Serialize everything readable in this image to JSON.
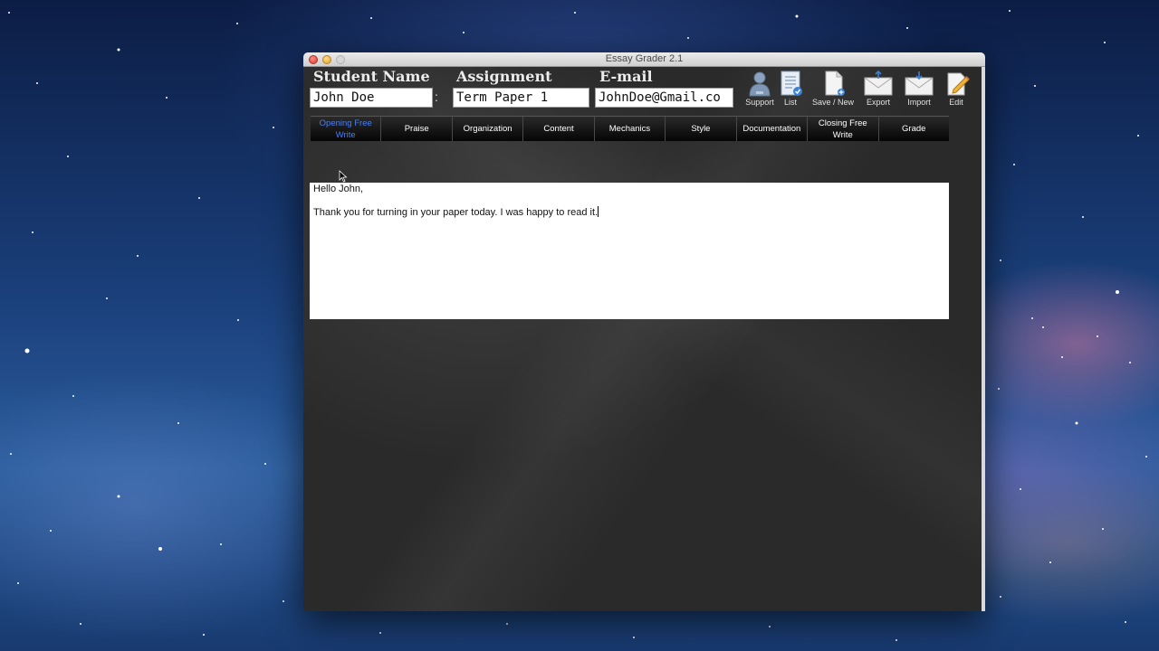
{
  "window": {
    "title": "Essay Grader 2.1"
  },
  "fields": {
    "student_name": {
      "label": "Student Name",
      "value": "John Doe"
    },
    "separator": ":",
    "assignment": {
      "label": "Assignment",
      "value": "Term Paper 1"
    },
    "email": {
      "label": "E-mail",
      "value": "JohnDoe@Gmail.co"
    }
  },
  "toolbar": {
    "support": "Support",
    "list": "List",
    "save_new": "Save / New",
    "export": "Export",
    "import": "Import",
    "edit": "Edit"
  },
  "tabs": [
    {
      "label": "Opening Free Write",
      "active": true
    },
    {
      "label": "Praise"
    },
    {
      "label": "Organization"
    },
    {
      "label": "Content"
    },
    {
      "label": "Mechanics"
    },
    {
      "label": "Style"
    },
    {
      "label": "Documentation"
    },
    {
      "label": "Closing Free Write"
    },
    {
      "label": "Grade"
    }
  ],
  "editor": {
    "line1": "Hello John,",
    "line2": "Thank you for turning in your paper today.  I was happy to read it."
  },
  "colors": {
    "active_tab": "#4a7ef0",
    "panel": "#2c2c2c"
  }
}
